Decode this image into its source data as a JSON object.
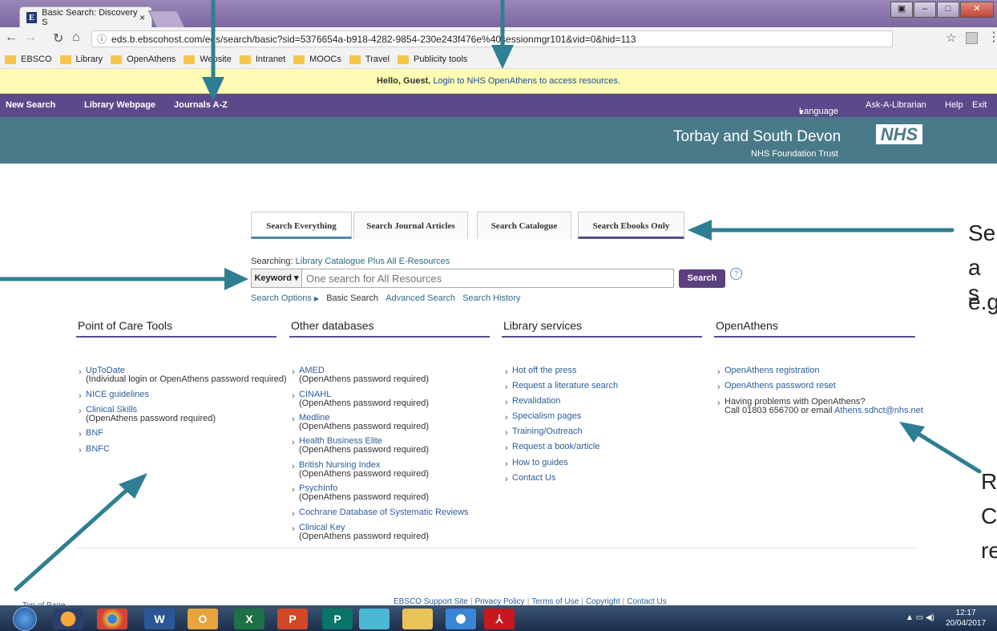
{
  "browser": {
    "tab_title": "Basic Search: Discovery S",
    "tab_close": "×",
    "url": "eds.b.ebscohost.com/eds/search/basic?sid=5376654a-b918-4282-9854-230e243f476e%40sessionmgr101&vid=0&hid=113",
    "bookmarks": [
      "EBSCO",
      "Library",
      "OpenAthens",
      "Website",
      "Intranet",
      "MOOCs",
      "Travel",
      "Publicity tools"
    ]
  },
  "guest_bar": {
    "hello": "Hello, Guest.",
    "login_link": "Login to NHS OpenAthens to access resources."
  },
  "topnav": {
    "left": [
      "New Search",
      "Library Webpage",
      "Journals A-Z"
    ],
    "language": "Language",
    "right": [
      "Ask-A-Librarian",
      "Help",
      "Exit"
    ]
  },
  "banner": {
    "org_name": "Torbay and South Devon",
    "org_sub": "NHS Foundation Trust",
    "nhs_logo": "NHS"
  },
  "search": {
    "tabs": [
      "Search Everything",
      "Search Journal Articles",
      "Search Catalogue",
      "Search Ebooks Only"
    ],
    "searching_label": "Searching:",
    "searching_value": "Library Catalogue Plus All E-Resources",
    "field_select": "Keyword",
    "placeholder": "One search for All Resources",
    "button": "Search",
    "help": "?",
    "links": {
      "options": "Search Options",
      "basic": "Basic Search",
      "advanced": "Advanced Search",
      "history": "Search History"
    }
  },
  "columns": {
    "poc": {
      "title": "Point of Care Tools",
      "items": [
        {
          "link": "UpToDate",
          "note": "(Individual login or OpenAthens password required)"
        },
        {
          "link": "NICE guidelines",
          "note": ""
        },
        {
          "link": "Clinical Skills",
          "note": "(OpenAthens password required)"
        },
        {
          "link": "BNF",
          "note": ""
        },
        {
          "link": "BNFC",
          "note": ""
        }
      ]
    },
    "db": {
      "title": "Other databases",
      "items": [
        {
          "link": "AMED",
          "note": "(OpenAthens password required)"
        },
        {
          "link": "CINAHL",
          "note": "(OpenAthens password required)"
        },
        {
          "link": "Medline",
          "note": "(OpenAthens password required)"
        },
        {
          "link": "Health Business Elite",
          "note": "(OpenAthens password required)"
        },
        {
          "link": "British Nursing Index",
          "note": "(OpenAthens password required)"
        },
        {
          "link": "PsychInfo",
          "note": "(OpenAthens password required)"
        },
        {
          "link": "Cochrane Database of Systematic Reviews",
          "note": ""
        },
        {
          "link": "Clinical Key",
          "note": "(OpenAthens password required)"
        }
      ]
    },
    "lib": {
      "title": "Library services",
      "items": [
        "Hot off the press",
        "Request a literature search",
        "Revalidation",
        "Specialism pages",
        "Training/Outreach",
        "Request a book/article",
        "How to guides",
        "Contact Us"
      ]
    },
    "oa": {
      "title": "OpenAthens",
      "items": [
        "OpenAthens registration",
        "OpenAthens password reset"
      ],
      "problem_line1": "Having problems with OpenAthens?",
      "problem_line2": "Call 01803 656700 or email ",
      "problem_email": "Athens.sdhct@nhs.net"
    }
  },
  "footer": {
    "top_of_page": "Top of Page",
    "links": [
      "EBSCO Support Site",
      "Privacy Policy",
      "Terms of Use",
      "Copyright",
      "Contact Us"
    ]
  },
  "annotations": {
    "a1": "Se",
    "a2": "a s",
    "a3": "e.g",
    "a4": "R",
    "a5": "C",
    "a6": "re"
  },
  "taskbar": {
    "time": "12:17",
    "date": "20/04/2017"
  },
  "colors": {
    "purple": "#5b4a8b",
    "teal": "#497a8a",
    "arrow": "#2f7f93"
  }
}
